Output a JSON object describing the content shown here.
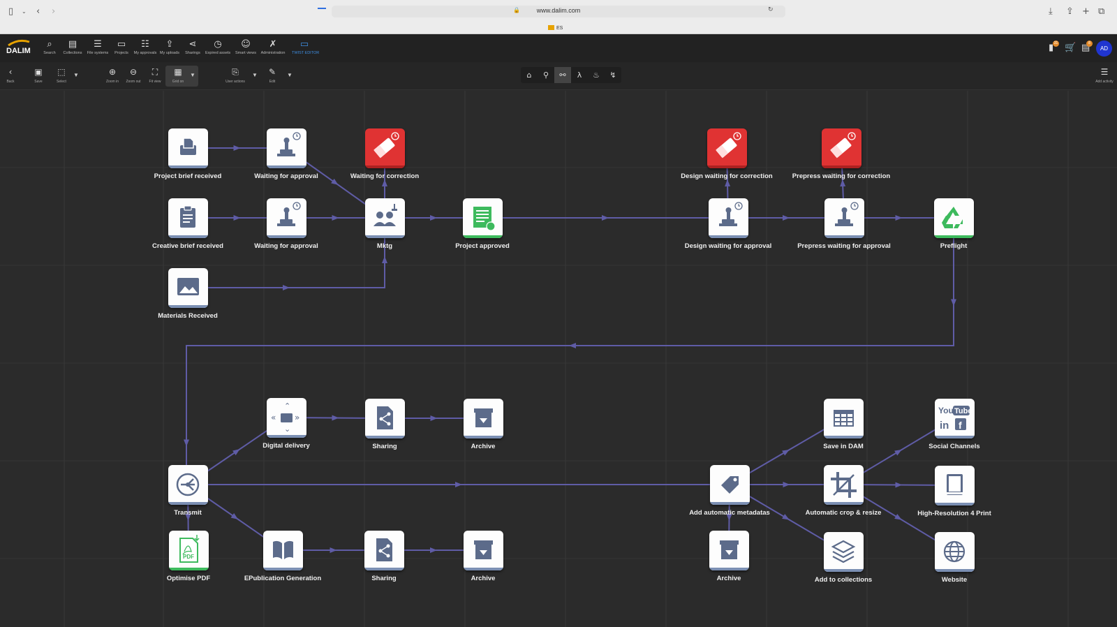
{
  "browser": {
    "url": "www.dalim.com",
    "tab_label": "ES"
  },
  "app": {
    "nav": [
      {
        "label": "Search",
        "icon": "search-icon"
      },
      {
        "label": "Collections",
        "icon": "collections-icon"
      },
      {
        "label": "File systems",
        "icon": "database-icon"
      },
      {
        "label": "Projects",
        "icon": "briefcase-icon"
      },
      {
        "label": "My approvals",
        "icon": "checklist-icon"
      },
      {
        "label": "My uploads",
        "icon": "upload-icon"
      },
      {
        "label": "Sharings",
        "icon": "share-icon"
      },
      {
        "label": "Expired assets",
        "icon": "clock-icon"
      },
      {
        "label": "Smart views",
        "icon": "user-search-icon"
      },
      {
        "label": "Administration",
        "icon": "wrench-icon"
      },
      {
        "label": "TWIST EDITOR",
        "icon": "monitor-icon",
        "active": true
      }
    ],
    "badges": {
      "notifications": "31",
      "tasks": "8"
    },
    "avatar_initials": "AD",
    "accent_color": "#3f8fe3"
  },
  "toolbar": {
    "back": "Back",
    "save": "Save",
    "select": "Select",
    "zoom_in": "Zoom in",
    "zoom_out": "Zoom out",
    "fit_view": "Fit view",
    "grid_on": "Grid on",
    "user_actions": "User actions",
    "edit": "Edit",
    "add_activity": "Add activity"
  },
  "workflow": {
    "colors": {
      "edge": "#5f5ca6",
      "alert": "#e03333",
      "approved": "#3dba5d",
      "default_stripe": "#7b8fb3"
    },
    "nodes": {
      "project_brief": {
        "label": "Project brief received",
        "icon": "inbox-icon",
        "style": "default"
      },
      "waiting_approval_1": {
        "label": "Waiting for approval",
        "icon": "approval-stamp-icon",
        "style": "default"
      },
      "waiting_correction_1": {
        "label": "Waiting for correction",
        "icon": "eraser-icon",
        "style": "red"
      },
      "creative_brief": {
        "label": "Creative brief received",
        "icon": "clipboard-icon",
        "style": "default"
      },
      "waiting_approval_2": {
        "label": "Waiting for approval",
        "icon": "approval-stamp-icon",
        "style": "default"
      },
      "mktg": {
        "label": "Mktg",
        "icon": "team-icon",
        "style": "default"
      },
      "project_approved": {
        "label": "Project approved",
        "icon": "document-approved-icon",
        "style": "green"
      },
      "materials_received": {
        "label": "Materials Received",
        "icon": "image-icon",
        "style": "default"
      },
      "design_correction": {
        "label": "Design waiting for correction",
        "icon": "eraser-icon",
        "style": "red"
      },
      "prepress_correction": {
        "label": "Prepress waiting for correction",
        "icon": "eraser-icon",
        "style": "red"
      },
      "design_approval": {
        "label": "Design waiting for approval",
        "icon": "approval-stamp-icon",
        "style": "default"
      },
      "prepress_approval": {
        "label": "Prepress waiting for approval",
        "icon": "approval-stamp-icon",
        "style": "default"
      },
      "preflight": {
        "label": "Preflight",
        "icon": "recycle-icon",
        "style": "green"
      },
      "digital_delivery": {
        "label": "Digital delivery",
        "icon": "folder-arrows-icon",
        "style": "default"
      },
      "sharing_1": {
        "label": "Sharing",
        "icon": "share-document-icon",
        "style": "default"
      },
      "archive_1": {
        "label": "Archive",
        "icon": "archive-box-icon",
        "style": "default"
      },
      "transmit": {
        "label": "Transmit",
        "icon": "transmit-icon",
        "style": "default"
      },
      "optimise_pdf": {
        "label": "Optimise PDF",
        "icon": "pdf-icon",
        "style": "green"
      },
      "epublication": {
        "label": "EPublication Generation",
        "icon": "open-book-icon",
        "style": "default"
      },
      "sharing_2": {
        "label": "Sharing",
        "icon": "share-document-icon",
        "style": "default"
      },
      "archive_2": {
        "label": "Archive",
        "icon": "archive-box-icon",
        "style": "default"
      },
      "add_metadatas": {
        "label": "Add automatic metadatas",
        "icon": "tag-icon",
        "style": "default"
      },
      "archive_3": {
        "label": "Archive",
        "icon": "archive-box-icon",
        "style": "default"
      },
      "save_dam": {
        "label": "Save in DAM",
        "icon": "table-icon",
        "style": "default"
      },
      "crop_resize": {
        "label": "Automatic crop & resize",
        "icon": "crop-icon",
        "style": "default"
      },
      "add_collections": {
        "label": "Add to collections",
        "icon": "layers-icon",
        "style": "default"
      },
      "social_channels": {
        "label": "Social Channels",
        "icon": "social-logos-icon",
        "style": "default",
        "logo_text": {
          "you": "You",
          "tube": "Tube",
          "in": "in",
          "f": "f"
        }
      },
      "hires_print": {
        "label": "High-Resolution 4 Print",
        "icon": "book-icon",
        "style": "default"
      },
      "website": {
        "label": "Website",
        "icon": "globe-icon",
        "style": "default"
      }
    }
  }
}
